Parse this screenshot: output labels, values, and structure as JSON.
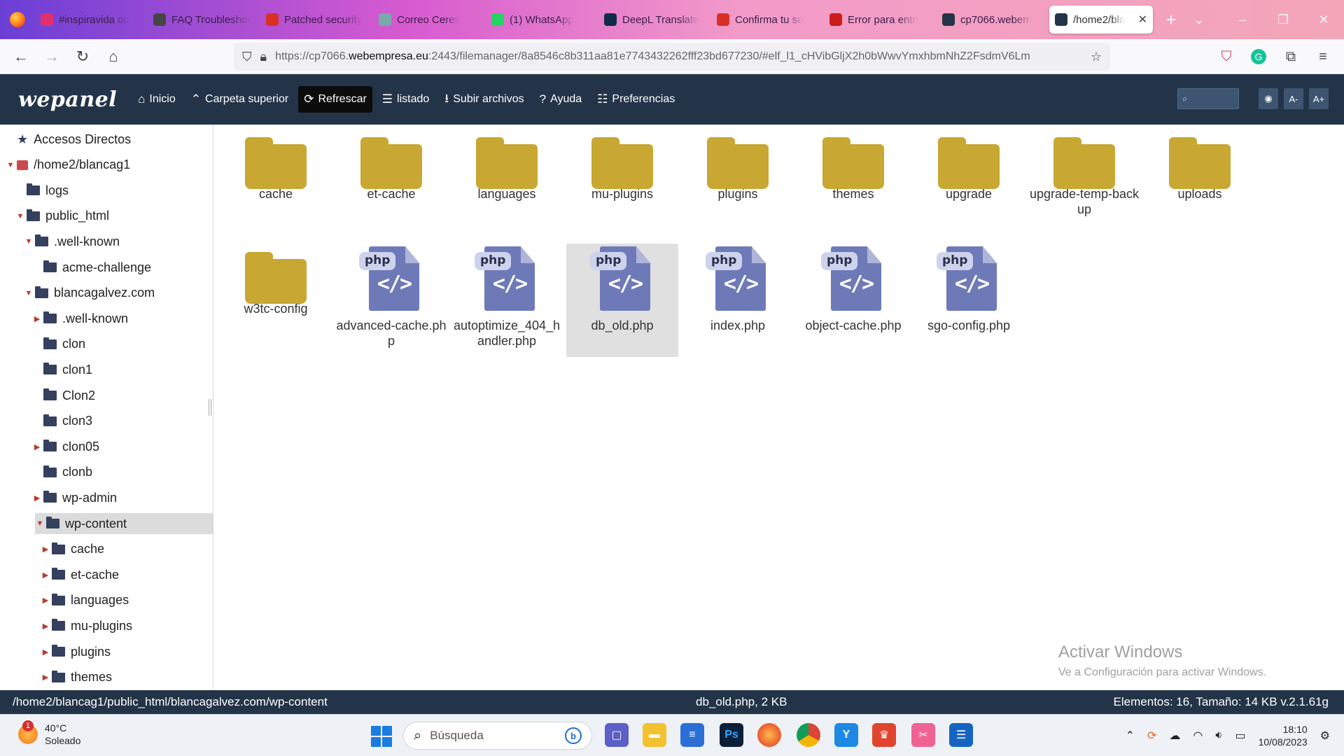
{
  "browser": {
    "tabs": [
      {
        "title": "#inspiravida on",
        "fav": "instagram-icon",
        "color": "#e1306c"
      },
      {
        "title": "FAQ Troubleshoot",
        "fav": "wordpress-icon",
        "color": "#464646"
      },
      {
        "title": "Patched security",
        "fav": "gmail-icon",
        "color": "#d93025"
      },
      {
        "title": "Correo Ceres",
        "fav": "mail-icon",
        "color": "#7aa"
      },
      {
        "title": "(1) WhatsApp",
        "fav": "whatsapp-icon",
        "color": "#25d366"
      },
      {
        "title": "DeepL Translate",
        "fav": "deepl-icon",
        "color": "#0f2b46"
      },
      {
        "title": "Confirma tu su",
        "fav": "gmail-icon",
        "color": "#d93025"
      },
      {
        "title": "Error para entr",
        "fav": "webempresa-icon",
        "color": "#cc1b1b"
      },
      {
        "title": "cp7066.webem",
        "fav": "wepanel-icon",
        "color": "#243448"
      },
      {
        "title": "/home2/bla",
        "fav": "wepanel-icon",
        "color": "#243448",
        "active": true
      }
    ],
    "url_prefix": "https://cp7066.",
    "url_host": "webempresa.eu",
    "url_rest": ":2443/filemanager/8a8546c8b311aa81e7743432262fff23bd677230/#elf_l1_cHVibGljX2h0bWwvYmxhbmNhZ2FsdmV6Lm"
  },
  "toolbar": {
    "logo": "wepanel",
    "items": [
      {
        "label": "Inicio",
        "icon": "home-icon",
        "glyph": "⌂"
      },
      {
        "label": "Carpeta superior",
        "icon": "up-arrow-icon",
        "glyph": "⌃"
      },
      {
        "label": "Refrescar",
        "icon": "refresh-icon",
        "glyph": "⟳",
        "active": true
      },
      {
        "label": "listado",
        "icon": "list-icon",
        "glyph": "☰"
      },
      {
        "label": "Subir archivos",
        "icon": "upload-icon",
        "glyph": "⭳"
      },
      {
        "label": "Ayuda",
        "icon": "help-icon",
        "glyph": "?"
      },
      {
        "label": "Preferencias",
        "icon": "settings-icon",
        "glyph": "☷"
      }
    ],
    "font_minus": "A-",
    "font_plus": "A+"
  },
  "tree": [
    {
      "label": "Accesos Directos",
      "level": 0,
      "kind": "star"
    },
    {
      "label": "/home2/blancag1",
      "level": 0,
      "kind": "drive",
      "arrow": "open"
    },
    {
      "label": "logs",
      "level": 1,
      "kind": "folder"
    },
    {
      "label": "public_html",
      "level": 1,
      "kind": "folder",
      "arrow": "open"
    },
    {
      "label": ".well-known",
      "level": 2,
      "kind": "folder",
      "arrow": "open"
    },
    {
      "label": "acme-challenge",
      "level": 3,
      "kind": "folder"
    },
    {
      "label": "blancagalvez.com",
      "level": 2,
      "kind": "folder",
      "arrow": "open"
    },
    {
      "label": ".well-known",
      "level": 3,
      "kind": "folder",
      "arrow": "closed"
    },
    {
      "label": "clon",
      "level": 3,
      "kind": "folder"
    },
    {
      "label": "clon1",
      "level": 3,
      "kind": "folder"
    },
    {
      "label": "Clon2",
      "level": 3,
      "kind": "folder"
    },
    {
      "label": "clon3",
      "level": 3,
      "kind": "folder"
    },
    {
      "label": "clon05",
      "level": 3,
      "kind": "folder",
      "arrow": "closed"
    },
    {
      "label": "clonb",
      "level": 3,
      "kind": "folder"
    },
    {
      "label": "wp-admin",
      "level": 3,
      "kind": "folder",
      "arrow": "closed"
    },
    {
      "label": "wp-content",
      "level": 3,
      "kind": "folder",
      "arrow": "open",
      "selected": true
    },
    {
      "label": "cache",
      "level": 4,
      "kind": "folder",
      "arrow": "closed"
    },
    {
      "label": "et-cache",
      "level": 4,
      "kind": "folder",
      "arrow": "closed"
    },
    {
      "label": "languages",
      "level": 4,
      "kind": "folder",
      "arrow": "closed"
    },
    {
      "label": "mu-plugins",
      "level": 4,
      "kind": "folder",
      "arrow": "closed"
    },
    {
      "label": "plugins",
      "level": 4,
      "kind": "folder",
      "arrow": "closed"
    },
    {
      "label": "themes",
      "level": 4,
      "kind": "folder",
      "arrow": "closed"
    }
  ],
  "files": [
    {
      "name": "cache",
      "type": "folder"
    },
    {
      "name": "et-cache",
      "type": "folder"
    },
    {
      "name": "languages",
      "type": "folder"
    },
    {
      "name": "mu-plugins",
      "type": "folder"
    },
    {
      "name": "plugins",
      "type": "folder"
    },
    {
      "name": "themes",
      "type": "folder"
    },
    {
      "name": "upgrade",
      "type": "folder"
    },
    {
      "name": "upgrade-temp-backup",
      "type": "folder"
    },
    {
      "name": "uploads",
      "type": "folder"
    },
    {
      "name": "w3tc-config",
      "type": "folder"
    },
    {
      "name": "advanced-cache.php",
      "type": "php"
    },
    {
      "name": "autoptimize_404_handler.php",
      "type": "php"
    },
    {
      "name": "db_old.php",
      "type": "php",
      "selected": true
    },
    {
      "name": "index.php",
      "type": "php"
    },
    {
      "name": "object-cache.php",
      "type": "php"
    },
    {
      "name": "sgo-config.php",
      "type": "php"
    }
  ],
  "php_badge": "php",
  "php_code": "</>",
  "watermark": {
    "title": "Activar Windows",
    "subtitle": "Ve a Configuración para activar Windows."
  },
  "status": {
    "path": "/home2/blancag1/public_html/blancagalvez.com/wp-content",
    "selection": "db_old.php, 2 KB",
    "summary": "Elementos: 16, Tamaño: 14 KB v.2.1.61g"
  },
  "taskbar": {
    "temp": "40°C",
    "weather": "Soleado",
    "weather_badge": "1",
    "search_placeholder": "Búsqueda",
    "time": "18:10",
    "date": "10/08/2023"
  }
}
